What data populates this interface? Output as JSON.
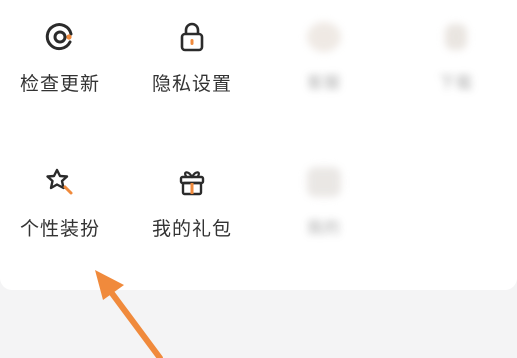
{
  "grid": {
    "row1": [
      {
        "label": "检查更新",
        "icon": "check-update-icon"
      },
      {
        "label": "隐私设置",
        "icon": "lock-icon"
      },
      {
        "label": "客服",
        "icon": "support-icon"
      },
      {
        "label": "下载",
        "icon": "download-icon"
      }
    ],
    "row2": [
      {
        "label": "个性装扮",
        "icon": "magic-wand-icon"
      },
      {
        "label": "我的礼包",
        "icon": "gift-icon"
      },
      {
        "label": "我的",
        "icon": "placeholder-icon"
      }
    ]
  },
  "colors": {
    "accent": "#f08a3c",
    "icon": "#2b2b2b",
    "text": "#333333",
    "panel": "#ffffff",
    "background": "#f4f4f5"
  }
}
